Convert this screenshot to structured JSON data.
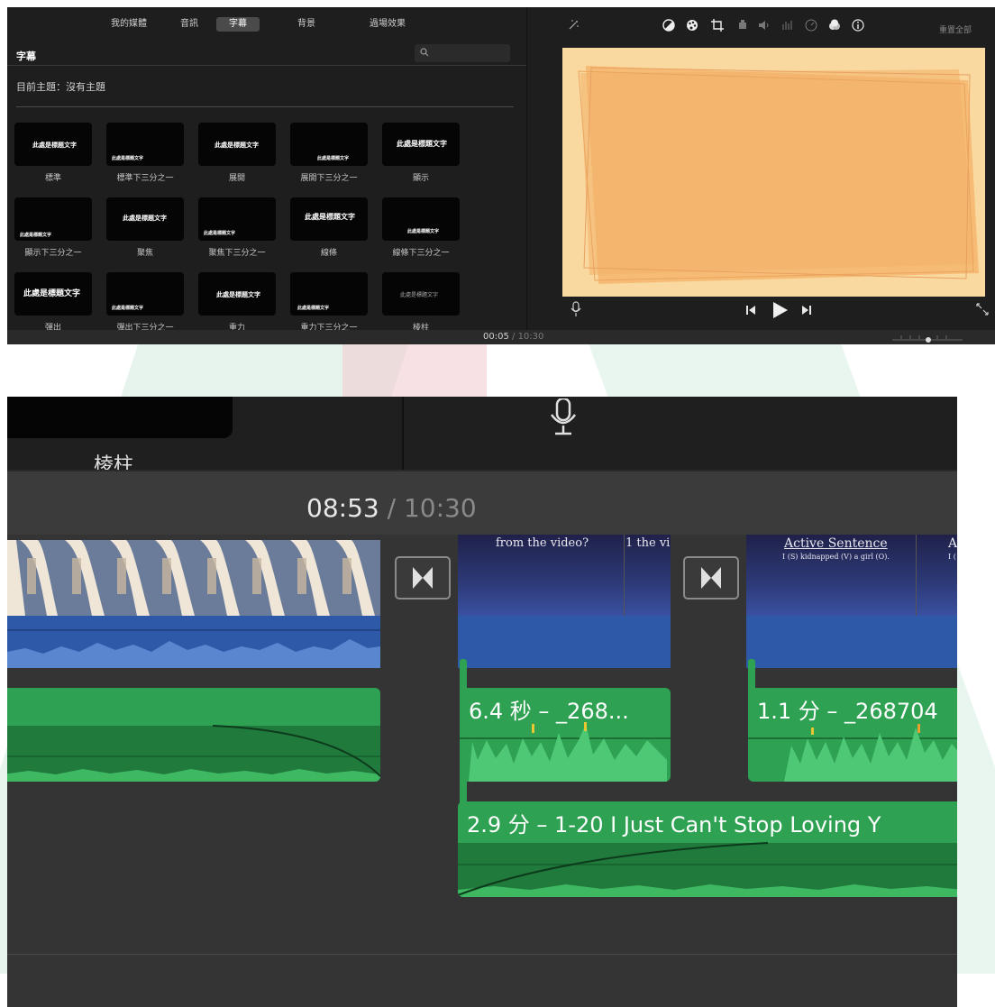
{
  "tabs": [
    "我的媒體",
    "音訊",
    "字幕",
    "背景",
    "過場效果"
  ],
  "panel": {
    "title": "字幕",
    "theme": "目前主題：沒有主題",
    "search_placeholder": ""
  },
  "tiles": [
    {
      "label": "標準",
      "thumb": "此處是標題文字"
    },
    {
      "label": "標準下三分之一",
      "thumb": "此處是標題文字"
    },
    {
      "label": "展開",
      "thumb": "此處是標題文字"
    },
    {
      "label": "展開下三分之一",
      "thumb": "此處是標題文字"
    },
    {
      "label": "顯示",
      "thumb": "此處是標題文字"
    },
    {
      "label": "顯示下三分之一",
      "thumb": "此處是標題文字"
    },
    {
      "label": "聚焦",
      "thumb": "此處是標題文字"
    },
    {
      "label": "聚焦下三分之一",
      "thumb": "此處是標題文字"
    },
    {
      "label": "線條",
      "thumb": "此處是標題文字"
    },
    {
      "label": "線條下三分之一",
      "thumb": "此處是標題文字"
    },
    {
      "label": "彈出",
      "thumb": "此處是標題文字"
    },
    {
      "label": "彈出下三分之一",
      "thumb": "此處是標題文字"
    },
    {
      "label": "重力",
      "thumb": "此處是標題文字"
    },
    {
      "label": "重力下三分之一",
      "thumb": "此處是標題文字"
    },
    {
      "label": "棱柱",
      "thumb": "此處是標題文字"
    }
  ],
  "viewer": {
    "reset_label": "重置全部",
    "icons": [
      "magic-wand-icon",
      "color-balance-icon",
      "color-palette-icon",
      "crop-icon",
      "stabilize-icon",
      "volume-icon",
      "equalizer-icon",
      "speed-icon",
      "filter-icon",
      "info-icon"
    ]
  },
  "playback": {
    "current": "00:05",
    "separator": " / ",
    "total": "10:30"
  },
  "zoom": {
    "tile_label": "棱柱",
    "current": "08:53",
    "separator": " / ",
    "total": "10:30",
    "clips": [
      {
        "label": "6.4 秒 – _268..."
      },
      {
        "label": "1.1 分 – _268704"
      },
      {
        "label": "2.9 分 – 1-20 I Just Can't Stop Loving Y"
      }
    ],
    "slides": [
      {
        "text": "from the video?"
      },
      {
        "text": "1 the vi"
      },
      {
        "text": "Active Sentence"
      },
      {
        "text": "I (S) kidnapped (V) a girl (O)."
      },
      {
        "text": "A"
      },
      {
        "text": "I ("
      }
    ]
  },
  "colors": {
    "preview_bg": "#f9d9a0",
    "preview_shape": "#f5b870",
    "audio_green": "#2ea252",
    "video_blue": "#2e58a8"
  }
}
